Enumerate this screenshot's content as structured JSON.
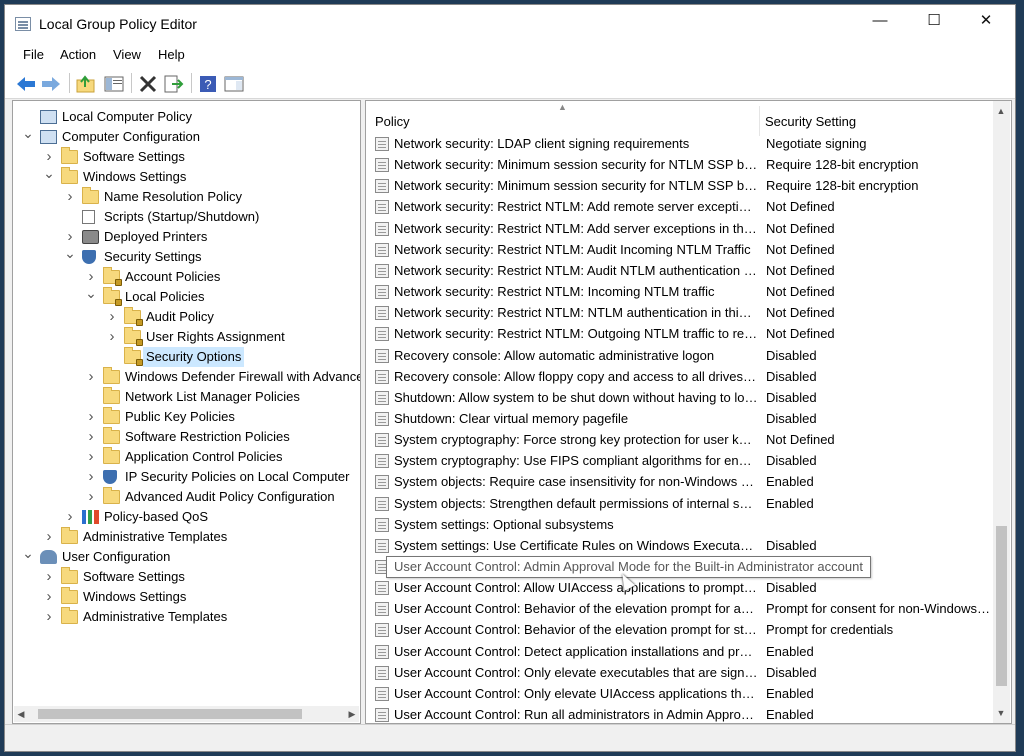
{
  "window": {
    "title": "Local Group Policy Editor",
    "min_glyph": "—",
    "max_glyph": "☐",
    "close_glyph": "✕"
  },
  "menu": [
    "File",
    "Action",
    "View",
    "Help"
  ],
  "toolbar": {
    "buttons": [
      "back-icon",
      "forward-icon",
      "up-folder-icon",
      "show-hide-tree-icon",
      "delete-icon",
      "export-list-icon",
      "help-icon",
      "properties-pane-icon"
    ],
    "colors": {
      "back": "#2b78d4",
      "forward": "#2b78d4",
      "help": "#3b5bb5"
    }
  },
  "tree": {
    "items": [
      {
        "label": "Local Computer Policy",
        "level": 0,
        "icon": "computer-icon",
        "expander": "",
        "selected": false
      },
      {
        "label": "Computer Configuration",
        "level": 0,
        "icon": "computer-icon",
        "expander": "open",
        "selected": false
      },
      {
        "label": "Software Settings",
        "level": 1,
        "icon": "folder-icon",
        "expander": "closed",
        "selected": false
      },
      {
        "label": "Windows Settings",
        "level": 1,
        "icon": "folder-icon",
        "expander": "open",
        "selected": false
      },
      {
        "label": "Name Resolution Policy",
        "level": 2,
        "icon": "folder-icon",
        "expander": "closed",
        "selected": false
      },
      {
        "label": "Scripts (Startup/Shutdown)",
        "level": 2,
        "icon": "document-icon",
        "expander": "",
        "selected": false
      },
      {
        "label": "Deployed Printers",
        "level": 2,
        "icon": "printer-icon",
        "expander": "closed",
        "selected": false
      },
      {
        "label": "Security Settings",
        "level": 2,
        "icon": "shield-icon",
        "expander": "open",
        "selected": false
      },
      {
        "label": "Account Policies",
        "level": 3,
        "icon": "lock-folder-icon",
        "expander": "closed",
        "selected": false
      },
      {
        "label": "Local Policies",
        "level": 3,
        "icon": "lock-folder-icon",
        "expander": "open",
        "selected": false
      },
      {
        "label": "Audit Policy",
        "level": 4,
        "icon": "lock-folder-icon",
        "expander": "closed",
        "selected": false
      },
      {
        "label": "User Rights Assignment",
        "level": 4,
        "icon": "lock-folder-icon",
        "expander": "closed",
        "selected": false
      },
      {
        "label": "Security Options",
        "level": 4,
        "icon": "lock-folder-icon",
        "expander": "",
        "selected": true
      },
      {
        "label": "Windows Defender Firewall with Advanced Security",
        "level": 3,
        "icon": "folder-icon",
        "expander": "closed",
        "selected": false
      },
      {
        "label": "Network List Manager Policies",
        "level": 3,
        "icon": "folder-icon",
        "expander": "",
        "selected": false
      },
      {
        "label": "Public Key Policies",
        "level": 3,
        "icon": "folder-icon",
        "expander": "closed",
        "selected": false
      },
      {
        "label": "Software Restriction Policies",
        "level": 3,
        "icon": "folder-icon",
        "expander": "closed",
        "selected": false
      },
      {
        "label": "Application Control Policies",
        "level": 3,
        "icon": "folder-icon",
        "expander": "closed",
        "selected": false
      },
      {
        "label": "IP Security Policies on Local Computer",
        "level": 3,
        "icon": "shield-icon",
        "expander": "closed",
        "selected": false
      },
      {
        "label": "Advanced Audit Policy Configuration",
        "level": 3,
        "icon": "folder-icon",
        "expander": "closed",
        "selected": false
      },
      {
        "label": "Policy-based QoS",
        "level": 2,
        "icon": "chart-icon",
        "expander": "closed",
        "selected": false
      },
      {
        "label": "Administrative Templates",
        "level": 1,
        "icon": "folder-icon",
        "expander": "closed",
        "selected": false
      },
      {
        "label": "User Configuration",
        "level": 0,
        "icon": "user-icon",
        "expander": "open",
        "selected": false
      },
      {
        "label": "Software Settings",
        "level": 1,
        "icon": "folder-icon",
        "expander": "closed",
        "selected": false
      },
      {
        "label": "Windows Settings",
        "level": 1,
        "icon": "folder-icon",
        "expander": "closed",
        "selected": false
      },
      {
        "label": "Administrative Templates",
        "level": 1,
        "icon": "folder-icon",
        "expander": "closed",
        "selected": false
      }
    ]
  },
  "list": {
    "columns": {
      "policy": "Policy",
      "setting": "Security Setting"
    },
    "rows": [
      {
        "policy": "Network security: LDAP client signing requirements",
        "setting": "Negotiate signing"
      },
      {
        "policy": "Network security: Minimum session security for NTLM SSP based (including secure RPC) clients",
        "setting": "Require 128-bit encryption"
      },
      {
        "policy": "Network security: Minimum session security for NTLM SSP based (including secure RPC) servers",
        "setting": "Require 128-bit encryption"
      },
      {
        "policy": "Network security: Restrict NTLM: Add remote server exceptions for NTLM authentication",
        "setting": "Not Defined"
      },
      {
        "policy": "Network security: Restrict NTLM: Add server exceptions in this domain",
        "setting": "Not Defined"
      },
      {
        "policy": "Network security: Restrict NTLM: Audit Incoming NTLM Traffic",
        "setting": "Not Defined"
      },
      {
        "policy": "Network security: Restrict NTLM: Audit NTLM authentication in this domain",
        "setting": "Not Defined"
      },
      {
        "policy": "Network security: Restrict NTLM: Incoming NTLM traffic",
        "setting": "Not Defined"
      },
      {
        "policy": "Network security: Restrict NTLM: NTLM authentication in this domain",
        "setting": "Not Defined"
      },
      {
        "policy": "Network security: Restrict NTLM: Outgoing NTLM traffic to remote servers",
        "setting": "Not Defined"
      },
      {
        "policy": "Recovery console: Allow automatic administrative logon",
        "setting": "Disabled"
      },
      {
        "policy": "Recovery console: Allow floppy copy and access to all drives and all folders",
        "setting": "Disabled"
      },
      {
        "policy": "Shutdown: Allow system to be shut down without having to log on",
        "setting": "Disabled"
      },
      {
        "policy": "Shutdown: Clear virtual memory pagefile",
        "setting": "Disabled"
      },
      {
        "policy": "System cryptography: Force strong key protection for user keys stored on the computer",
        "setting": "Not Defined"
      },
      {
        "policy": "System cryptography: Use FIPS compliant algorithms for encryption, hashing, and signing",
        "setting": "Disabled"
      },
      {
        "policy": "System objects: Require case insensitivity for non-Windows subsystems",
        "setting": "Enabled"
      },
      {
        "policy": "System objects: Strengthen default permissions of internal system objects",
        "setting": "Enabled"
      },
      {
        "policy": "System settings: Optional subsystems",
        "setting": ""
      },
      {
        "policy": "System settings: Use Certificate Rules on Windows Executables for Software Restriction Policies",
        "setting": "Disabled"
      },
      {
        "policy": "User Account Control: Admin Approval Mode for the Built-in Administrator account",
        "setting": ""
      },
      {
        "policy": "User Account Control: Allow UIAccess applications to prompt for elevation without using the secure desktop",
        "setting": "Disabled"
      },
      {
        "policy": "User Account Control: Behavior of the elevation prompt for administrators in Admin Approval Mode",
        "setting": "Prompt for consent for non-Windows binaries"
      },
      {
        "policy": "User Account Control: Behavior of the elevation prompt for standard users",
        "setting": "Prompt for credentials"
      },
      {
        "policy": "User Account Control: Detect application installations and prompt for elevation",
        "setting": "Enabled"
      },
      {
        "policy": "User Account Control: Only elevate executables that are signed and validated",
        "setting": "Disabled"
      },
      {
        "policy": "User Account Control: Only elevate UIAccess applications that are installed in secure locations",
        "setting": "Enabled"
      },
      {
        "policy": "User Account Control: Run all administrators in Admin Approval Mode",
        "setting": "Enabled"
      }
    ],
    "tooltip": "User Account Control: Admin Approval Mode for the Built-in Administrator account"
  }
}
